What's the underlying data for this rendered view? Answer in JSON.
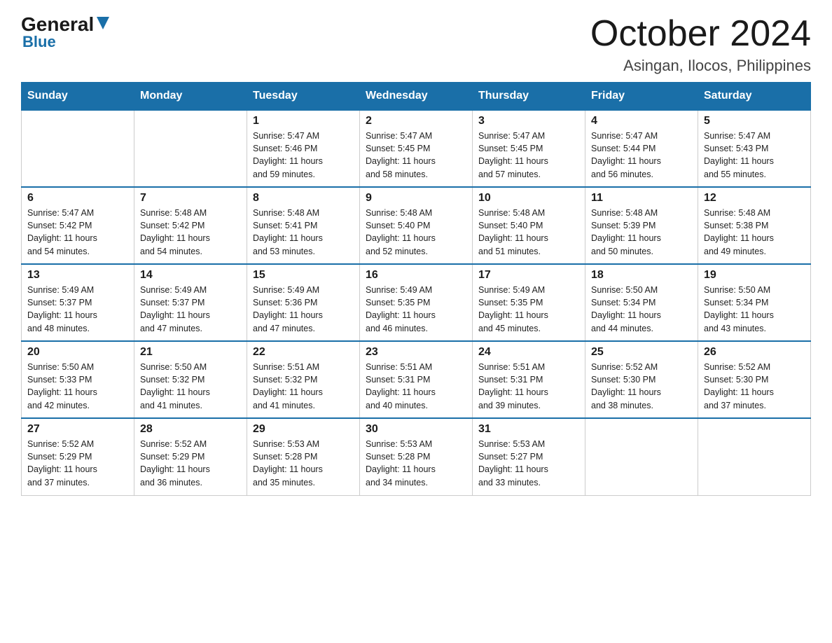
{
  "header": {
    "logo_general": "General",
    "logo_blue": "Blue",
    "month_title": "October 2024",
    "subtitle": "Asingan, Ilocos, Philippines"
  },
  "days_of_week": [
    "Sunday",
    "Monday",
    "Tuesday",
    "Wednesday",
    "Thursday",
    "Friday",
    "Saturday"
  ],
  "weeks": [
    [
      {
        "day": "",
        "info": ""
      },
      {
        "day": "",
        "info": ""
      },
      {
        "day": "1",
        "info": "Sunrise: 5:47 AM\nSunset: 5:46 PM\nDaylight: 11 hours\nand 59 minutes."
      },
      {
        "day": "2",
        "info": "Sunrise: 5:47 AM\nSunset: 5:45 PM\nDaylight: 11 hours\nand 58 minutes."
      },
      {
        "day": "3",
        "info": "Sunrise: 5:47 AM\nSunset: 5:45 PM\nDaylight: 11 hours\nand 57 minutes."
      },
      {
        "day": "4",
        "info": "Sunrise: 5:47 AM\nSunset: 5:44 PM\nDaylight: 11 hours\nand 56 minutes."
      },
      {
        "day": "5",
        "info": "Sunrise: 5:47 AM\nSunset: 5:43 PM\nDaylight: 11 hours\nand 55 minutes."
      }
    ],
    [
      {
        "day": "6",
        "info": "Sunrise: 5:47 AM\nSunset: 5:42 PM\nDaylight: 11 hours\nand 54 minutes."
      },
      {
        "day": "7",
        "info": "Sunrise: 5:48 AM\nSunset: 5:42 PM\nDaylight: 11 hours\nand 54 minutes."
      },
      {
        "day": "8",
        "info": "Sunrise: 5:48 AM\nSunset: 5:41 PM\nDaylight: 11 hours\nand 53 minutes."
      },
      {
        "day": "9",
        "info": "Sunrise: 5:48 AM\nSunset: 5:40 PM\nDaylight: 11 hours\nand 52 minutes."
      },
      {
        "day": "10",
        "info": "Sunrise: 5:48 AM\nSunset: 5:40 PM\nDaylight: 11 hours\nand 51 minutes."
      },
      {
        "day": "11",
        "info": "Sunrise: 5:48 AM\nSunset: 5:39 PM\nDaylight: 11 hours\nand 50 minutes."
      },
      {
        "day": "12",
        "info": "Sunrise: 5:48 AM\nSunset: 5:38 PM\nDaylight: 11 hours\nand 49 minutes."
      }
    ],
    [
      {
        "day": "13",
        "info": "Sunrise: 5:49 AM\nSunset: 5:37 PM\nDaylight: 11 hours\nand 48 minutes."
      },
      {
        "day": "14",
        "info": "Sunrise: 5:49 AM\nSunset: 5:37 PM\nDaylight: 11 hours\nand 47 minutes."
      },
      {
        "day": "15",
        "info": "Sunrise: 5:49 AM\nSunset: 5:36 PM\nDaylight: 11 hours\nand 47 minutes."
      },
      {
        "day": "16",
        "info": "Sunrise: 5:49 AM\nSunset: 5:35 PM\nDaylight: 11 hours\nand 46 minutes."
      },
      {
        "day": "17",
        "info": "Sunrise: 5:49 AM\nSunset: 5:35 PM\nDaylight: 11 hours\nand 45 minutes."
      },
      {
        "day": "18",
        "info": "Sunrise: 5:50 AM\nSunset: 5:34 PM\nDaylight: 11 hours\nand 44 minutes."
      },
      {
        "day": "19",
        "info": "Sunrise: 5:50 AM\nSunset: 5:34 PM\nDaylight: 11 hours\nand 43 minutes."
      }
    ],
    [
      {
        "day": "20",
        "info": "Sunrise: 5:50 AM\nSunset: 5:33 PM\nDaylight: 11 hours\nand 42 minutes."
      },
      {
        "day": "21",
        "info": "Sunrise: 5:50 AM\nSunset: 5:32 PM\nDaylight: 11 hours\nand 41 minutes."
      },
      {
        "day": "22",
        "info": "Sunrise: 5:51 AM\nSunset: 5:32 PM\nDaylight: 11 hours\nand 41 minutes."
      },
      {
        "day": "23",
        "info": "Sunrise: 5:51 AM\nSunset: 5:31 PM\nDaylight: 11 hours\nand 40 minutes."
      },
      {
        "day": "24",
        "info": "Sunrise: 5:51 AM\nSunset: 5:31 PM\nDaylight: 11 hours\nand 39 minutes."
      },
      {
        "day": "25",
        "info": "Sunrise: 5:52 AM\nSunset: 5:30 PM\nDaylight: 11 hours\nand 38 minutes."
      },
      {
        "day": "26",
        "info": "Sunrise: 5:52 AM\nSunset: 5:30 PM\nDaylight: 11 hours\nand 37 minutes."
      }
    ],
    [
      {
        "day": "27",
        "info": "Sunrise: 5:52 AM\nSunset: 5:29 PM\nDaylight: 11 hours\nand 37 minutes."
      },
      {
        "day": "28",
        "info": "Sunrise: 5:52 AM\nSunset: 5:29 PM\nDaylight: 11 hours\nand 36 minutes."
      },
      {
        "day": "29",
        "info": "Sunrise: 5:53 AM\nSunset: 5:28 PM\nDaylight: 11 hours\nand 35 minutes."
      },
      {
        "day": "30",
        "info": "Sunrise: 5:53 AM\nSunset: 5:28 PM\nDaylight: 11 hours\nand 34 minutes."
      },
      {
        "day": "31",
        "info": "Sunrise: 5:53 AM\nSunset: 5:27 PM\nDaylight: 11 hours\nand 33 minutes."
      },
      {
        "day": "",
        "info": ""
      },
      {
        "day": "",
        "info": ""
      }
    ]
  ]
}
